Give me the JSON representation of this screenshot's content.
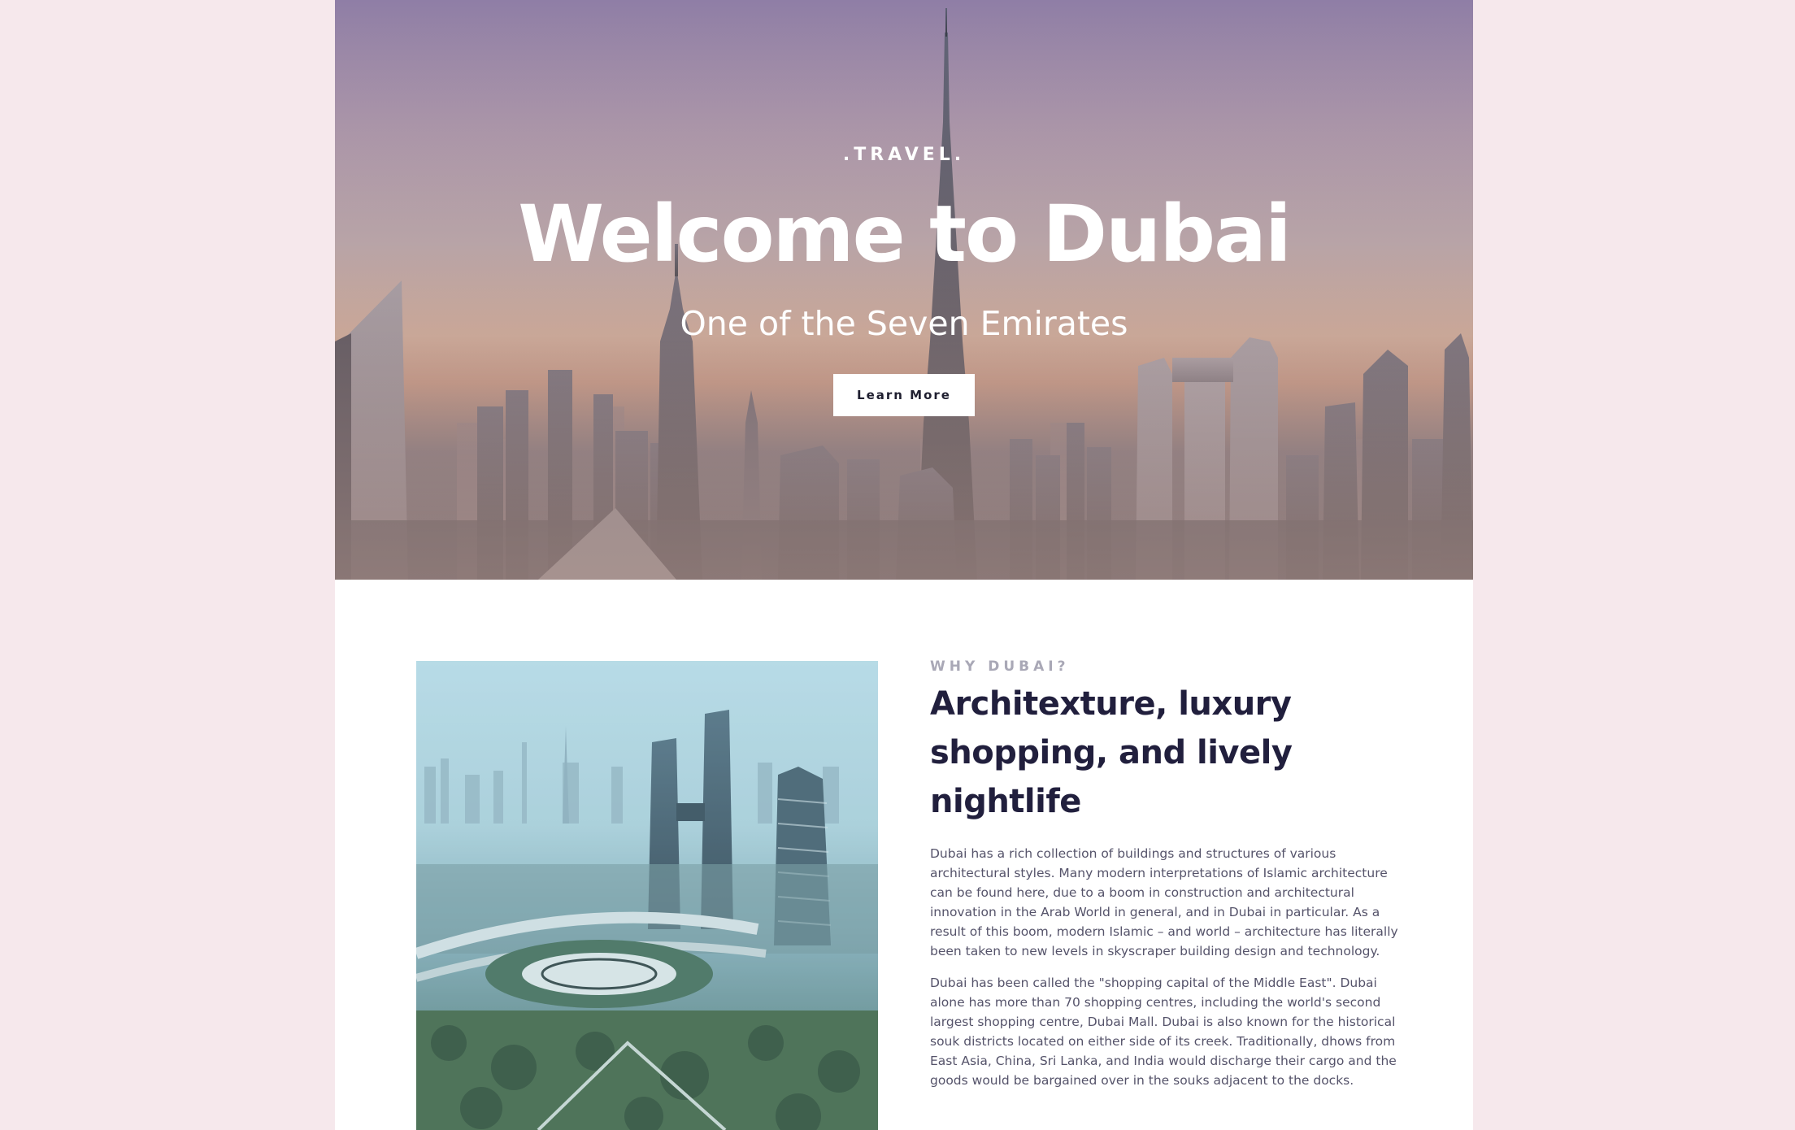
{
  "hero": {
    "eyebrow": ".TRAVEL.",
    "title": "Welcome to Dubai",
    "subtitle": "One of the Seven Emirates",
    "button_label": "Learn More"
  },
  "about": {
    "eyebrow": "WHY DUBAI?",
    "heading": "Architexture, luxury shopping, and lively nightlife",
    "paragraphs": [
      "Dubai has a rich collection of buildings and structures of various architectural styles. Many modern interpretations of Islamic architecture can be found here, due to a boom in construction and architectural innovation in the Arab World in general, and in Dubai in particular. As a result of this boom, modern Islamic – and world – architecture has literally been taken to new levels in skyscraper building design and technology.",
      "Dubai has been called the \"shopping capital of the Middle East\". Dubai alone has more than 70 shopping centres, including the world's second largest shopping centre, Dubai Mall. Dubai is also known for the historical souk districts located on either side of its creek. Traditionally, dhows from East Asia, China, Sri Lanka, and India would discharge their cargo and the goods would be bargained over in the souks adjacent to the docks."
    ]
  },
  "colors": {
    "page_background": "#f6e8ec",
    "heading": "#211f3d",
    "body_text": "#55536a",
    "eyebrow": "#a9a8b6"
  }
}
